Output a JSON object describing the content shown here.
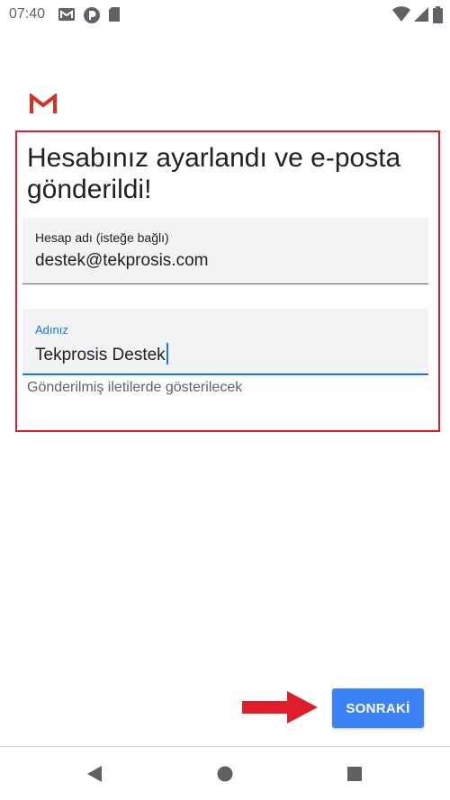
{
  "status_bar": {
    "time": "07:40",
    "left_icons": [
      "gmail-icon",
      "app-icon",
      "sd-card-icon"
    ],
    "right_icons": [
      "wifi-icon",
      "signal-icon",
      "battery-icon"
    ]
  },
  "app": {
    "logo": "gmail-logo"
  },
  "heading": "Hesabınız ayarlandı ve e-posta gönderildi!",
  "account_field": {
    "label": "Hesap adı (isteğe bağlı)",
    "value": "destek@tekprosis.com"
  },
  "name_field": {
    "label": "Adınız",
    "value": "Tekprosis Destek",
    "helper": "Gönderilmiş iletilerde gösterilecek"
  },
  "next_button": {
    "label": "SONRAKİ"
  },
  "annotation": {
    "arrow_color": "#e01e2b",
    "highlight_color": "#e01e2b"
  },
  "colors": {
    "accent": "#1a73e8",
    "button": "#3b82f6"
  },
  "nav_bar": {
    "icons": [
      "back-icon",
      "home-icon",
      "recents-icon"
    ]
  }
}
